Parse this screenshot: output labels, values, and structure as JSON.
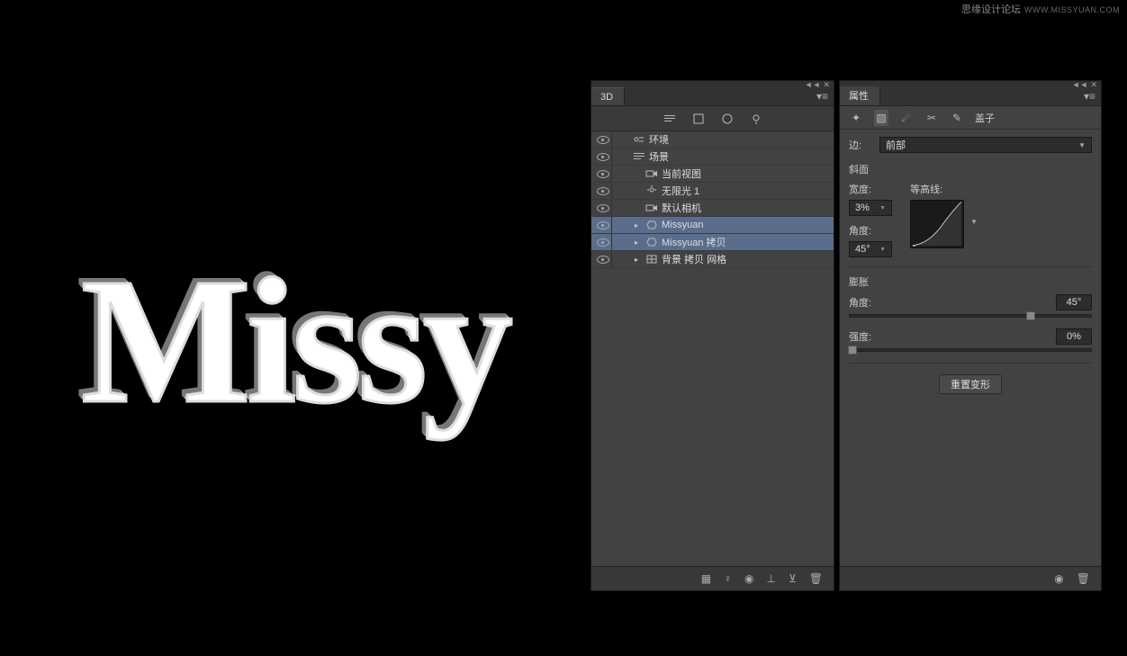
{
  "watermark": {
    "text": "思缘设计论坛",
    "url": "WWW.MISSYUAN.COM"
  },
  "canvas": {
    "text": "Missy"
  },
  "panel3d": {
    "tab": "3D",
    "rows": [
      {
        "label": "环境",
        "indent": 1,
        "icon": "env",
        "selected": false,
        "expand": false
      },
      {
        "label": "场景",
        "indent": 1,
        "icon": "scene",
        "selected": false,
        "expand": false
      },
      {
        "label": "当前视图",
        "indent": 2,
        "icon": "camera",
        "selected": false,
        "expand": false
      },
      {
        "label": "无限光 1",
        "indent": 2,
        "icon": "light",
        "selected": false,
        "expand": false
      },
      {
        "label": "默认相机",
        "indent": 2,
        "icon": "camera",
        "selected": false,
        "expand": false
      },
      {
        "label": "Missyuan",
        "indent": 2,
        "icon": "mesh",
        "selected": true,
        "expand": true
      },
      {
        "label": "Missyuan 拷贝",
        "indent": 2,
        "icon": "mesh",
        "selected": true,
        "expand": true
      },
      {
        "label": "背景 拷贝 网格",
        "indent": 2,
        "icon": "grid",
        "selected": false,
        "expand": true
      }
    ]
  },
  "props": {
    "tab": "属性",
    "header_suffix": "盖子",
    "edge_label": "边:",
    "edge_value": "前部",
    "bevel_label": "斜面",
    "width_label": "宽度:",
    "width_value": "3%",
    "contour_label": "等高线:",
    "angle_label": "角度:",
    "angle_value": "45°",
    "inflate_label": "膨胀",
    "inflate_angle_label": "角度:",
    "inflate_angle_value": "45°",
    "strength_label": "强度:",
    "strength_value": "0%",
    "reset_label": "重置变形"
  }
}
